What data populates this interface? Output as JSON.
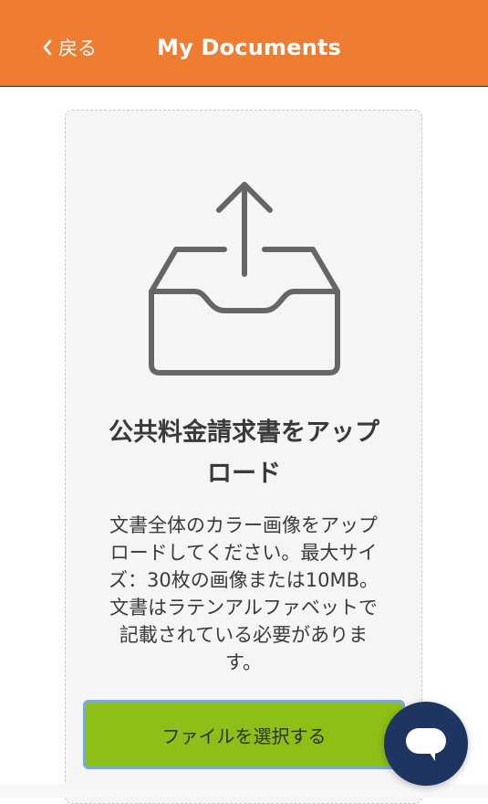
{
  "header": {
    "back_label": "戻る",
    "title": "My Documents",
    "background_color": "#ef7d31"
  },
  "upload": {
    "icon": "upload-tray-icon",
    "heading_line1": "公共料金請求書をアップ",
    "heading_line2": "ロード",
    "description_lines": [
      "文書全体のカラー画像をアップ",
      "ロードしてください。最大サイ",
      "ズ：30枚の画像または10MB。",
      "文書はラテンアルファベットで",
      "記載されている必要がありま",
      "す。"
    ],
    "button_label": "ファイルを選択する",
    "button_color": "#8dbf17"
  },
  "chat": {
    "icon": "chat-bubble-icon",
    "color": "#1f3561"
  }
}
